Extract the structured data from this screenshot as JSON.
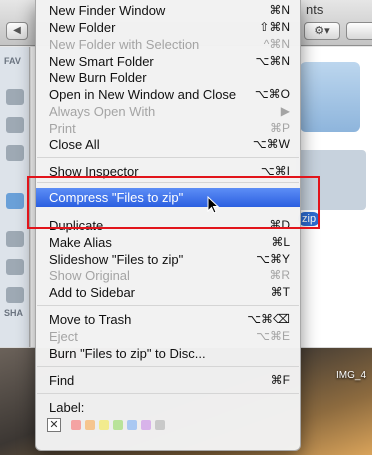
{
  "background": {
    "window_title_fragment": "nts",
    "back_button": "◀",
    "action_button": "⚙▾",
    "sidebar_favorites_label": "FAV",
    "sidebar_shared_label": "SHA",
    "selected_file_label": "zip",
    "desktop_file_label": "IMG_4"
  },
  "menu": {
    "items": [
      {
        "label": "New Finder Window",
        "shortcut": "⌘N",
        "enabled": true
      },
      {
        "label": "New Folder",
        "shortcut": "⇧⌘N",
        "enabled": true
      },
      {
        "label": "New Folder with Selection",
        "shortcut": "^⌘N",
        "enabled": false
      },
      {
        "label": "New Smart Folder",
        "shortcut": "⌥⌘N",
        "enabled": true
      },
      {
        "label": "New Burn Folder",
        "shortcut": "",
        "enabled": true
      },
      {
        "label": "Open in New Window and Close",
        "shortcut": "⌥⌘O",
        "enabled": true
      },
      {
        "label": "Always Open With",
        "shortcut": "▶",
        "enabled": false
      },
      {
        "label": "Print",
        "shortcut": "⌘P",
        "enabled": false
      },
      {
        "label": "Close All",
        "shortcut": "⌥⌘W",
        "enabled": true
      },
      {
        "label": "Show Inspector",
        "shortcut": "⌥⌘I",
        "enabled": true
      },
      {
        "label": "Compress \"Files to zip\"",
        "shortcut": "",
        "enabled": true,
        "highlighted": true
      },
      {
        "label": "Duplicate",
        "shortcut": "⌘D",
        "enabled": true
      },
      {
        "label": "Make Alias",
        "shortcut": "⌘L",
        "enabled": true
      },
      {
        "label": "Slideshow \"Files to zip\"",
        "shortcut": "⌥⌘Y",
        "enabled": true
      },
      {
        "label": "Show Original",
        "shortcut": "⌘R",
        "enabled": false
      },
      {
        "label": "Add to Sidebar",
        "shortcut": "⌘T",
        "enabled": true
      },
      {
        "label": "Move to Trash",
        "shortcut": "⌥⌘⌫",
        "enabled": true
      },
      {
        "label": "Eject",
        "shortcut": "⌥⌘E",
        "enabled": false
      },
      {
        "label": "Burn \"Files to zip\" to Disc...",
        "shortcut": "",
        "enabled": true
      },
      {
        "label": "Find",
        "shortcut": "⌘F",
        "enabled": true
      }
    ],
    "label_heading": "Label:",
    "label_none": "✕",
    "label_colors": [
      "#f4a3a3",
      "#f6c58f",
      "#f2eb8e",
      "#b9e39a",
      "#a9c8f2",
      "#d8b3ea",
      "#c9c9c9"
    ]
  },
  "annotation": {
    "highlight_color": "#e2141b"
  }
}
